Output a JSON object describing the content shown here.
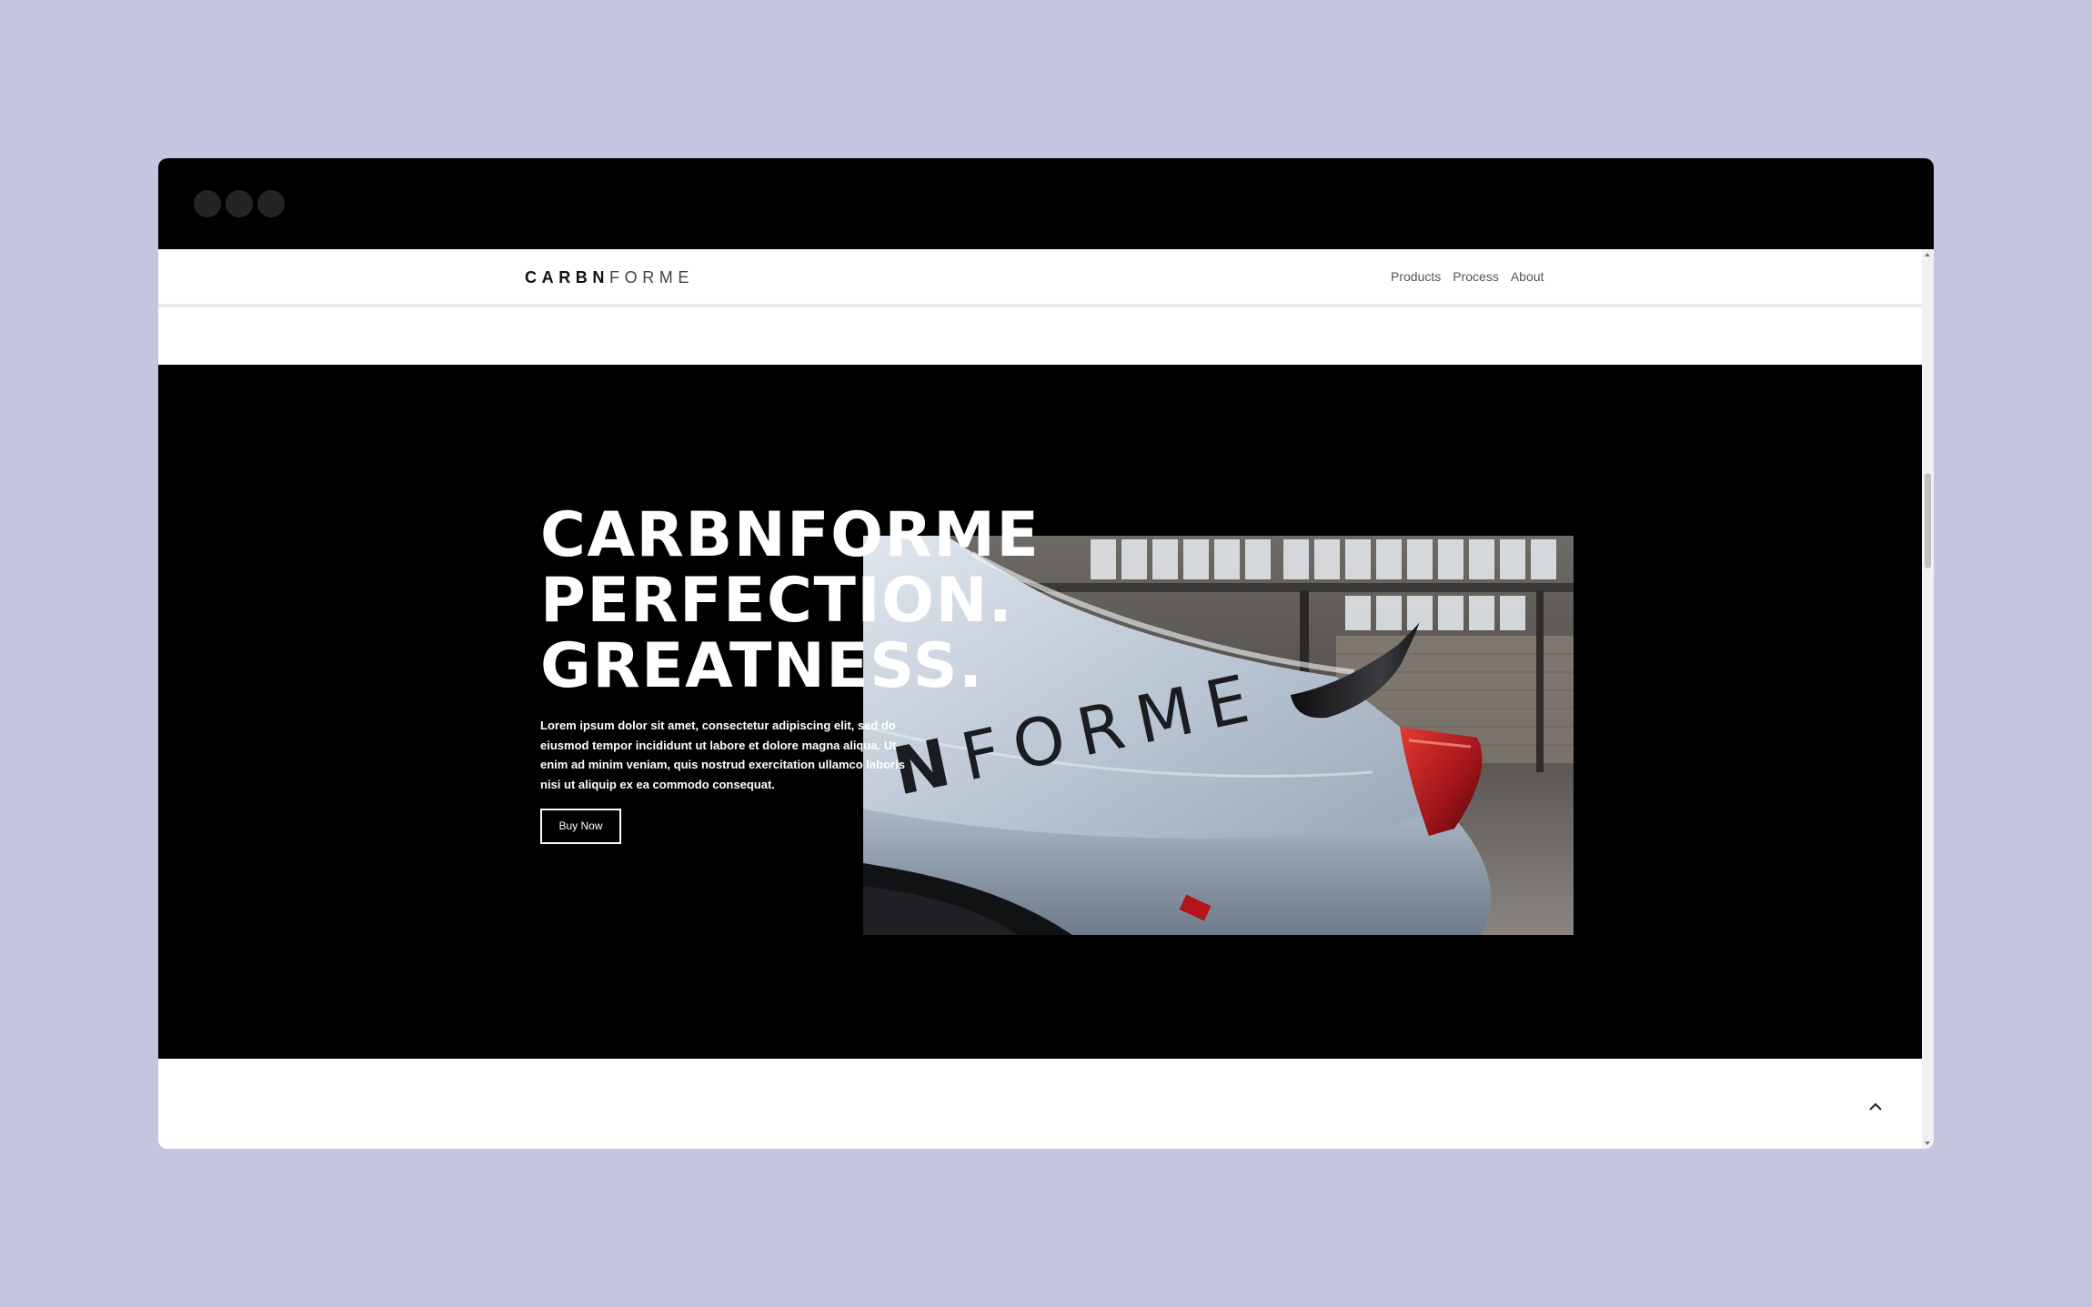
{
  "window": {
    "controls": [
      "close-dot",
      "minimize-dot",
      "maximize-dot"
    ],
    "titlebar_color": "#000000",
    "dot_color": "#242424"
  },
  "header": {
    "logo_bold": "CARBN",
    "logo_light": "FORME",
    "nav": [
      "Products",
      "Process",
      "About"
    ]
  },
  "hero": {
    "title_lines": [
      "CARBNFORME",
      "PERFECTION.",
      "GREATNESS."
    ],
    "body": "Lorem ipsum dolor sit amet, consectetur adipiscing elit, sed do eiusmod tempor incididunt ut labore et dolore magna aliqua. Ut enim ad minim veniam, quis nostrud exercitation ullamco laboris nisi ut aliquip ex ea commodo consequat.",
    "cta_label": "Buy Now",
    "image": {
      "subject": "white sports car rear with spoiler and red tail light in a warehouse",
      "decal_text": "NFORME"
    },
    "background_color": "#000000"
  },
  "footer": {
    "to_top_icon": "chevron-up-icon"
  },
  "colors": {
    "page_background": "#c5c5df",
    "accent_red": "#b3141a",
    "car_white": "#c9d3de"
  }
}
